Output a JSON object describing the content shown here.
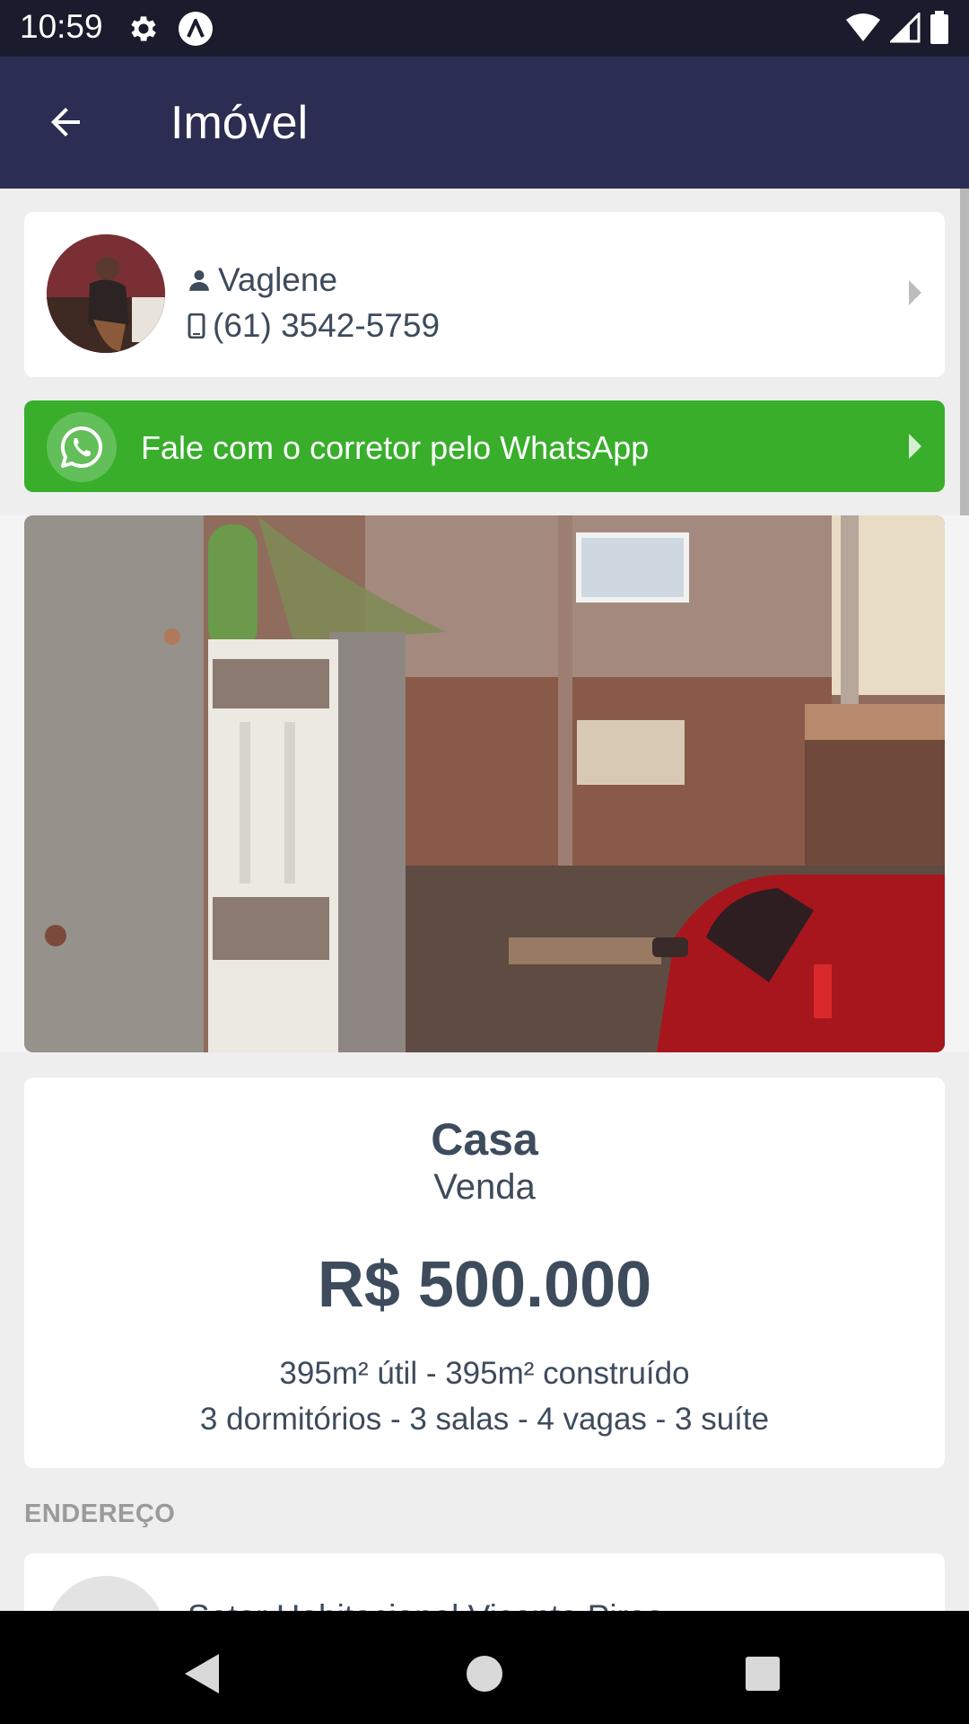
{
  "status_bar": {
    "time": "10:59",
    "icons": [
      "gear-icon",
      "a-logo-icon",
      "wifi-icon",
      "signal-icon",
      "battery-icon"
    ]
  },
  "app_bar": {
    "title": "Imóvel",
    "back_icon": "arrow-back-icon"
  },
  "broker": {
    "name": "Vaglene",
    "phone": "(61) 3542-5759",
    "name_icon": "person-icon",
    "phone_icon": "phone-icon"
  },
  "whatsapp": {
    "label": "Fale com o corretor pelo WhatsApp",
    "icon": "whatsapp-icon",
    "color": "#38ae2b"
  },
  "property": {
    "type": "Casa",
    "deal": "Venda",
    "price": "R$ 500.000",
    "area": "395m² útil - 395m² construído",
    "rooms": "3 dormitórios - 3 salas - 4 vagas - 3 suíte"
  },
  "address": {
    "section_label": "ENDEREÇO",
    "line": "Setor Habitacional Vicente Pires"
  },
  "nav_bar": {
    "icons": [
      "back-triangle-icon",
      "home-circle-icon",
      "recents-square-icon"
    ]
  },
  "colors": {
    "app_bar": "#2b2d52",
    "status_bar": "#1a1b2c",
    "text": "#3d4b5c",
    "background": "#eeeeee"
  }
}
